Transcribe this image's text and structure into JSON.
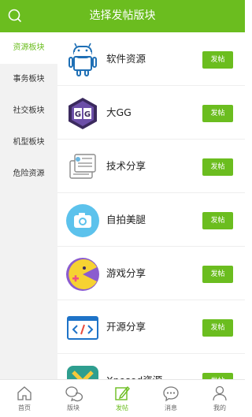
{
  "header": {
    "title": "选择发帖版块",
    "search_icon": "search-icon"
  },
  "colors": {
    "accent": "#6bbd1f",
    "sidebar_bg": "#f2f2f2"
  },
  "sidebar": {
    "items": [
      {
        "label": "资源板块",
        "active": true
      },
      {
        "label": "事务板块",
        "active": false
      },
      {
        "label": "社交板块",
        "active": false
      },
      {
        "label": "机型板块",
        "active": false
      },
      {
        "label": "危险资源",
        "active": false
      }
    ]
  },
  "sections": [
    {
      "name": "软件资源",
      "icon": "android-icon",
      "action": "发帖"
    },
    {
      "name": "大GG",
      "icon": "gg-logo-icon",
      "action": "发帖"
    },
    {
      "name": "技术分享",
      "icon": "document-icon",
      "action": "发帖"
    },
    {
      "name": "自拍美腿",
      "icon": "camera-icon",
      "action": "发帖"
    },
    {
      "name": "游戏分享",
      "icon": "pacman-game-icon",
      "action": "发帖"
    },
    {
      "name": "开源分享",
      "icon": "code-icon",
      "action": "发帖"
    },
    {
      "name": "Xposed资源",
      "icon": "xposed-icon",
      "action": "发帖"
    }
  ],
  "bottom_nav": {
    "tabs": [
      {
        "label": "首页",
        "icon": "home-icon",
        "active": false
      },
      {
        "label": "版块",
        "icon": "chat-bubbles-icon",
        "active": false
      },
      {
        "label": "发帖",
        "icon": "compose-icon",
        "active": true
      },
      {
        "label": "消息",
        "icon": "message-icon",
        "active": false
      },
      {
        "label": "我的",
        "icon": "user-icon",
        "active": false
      }
    ]
  }
}
